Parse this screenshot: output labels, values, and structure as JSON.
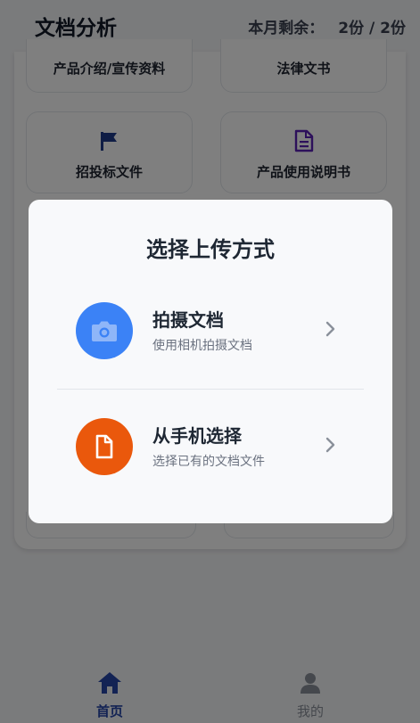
{
  "header": {
    "title": "文档分析",
    "quota_label": "本月剩余：",
    "quota_value": "2份 / 2份"
  },
  "categories": [
    {
      "label": "产品介绍/宣传资料",
      "icon": "none"
    },
    {
      "label": "法律文书",
      "icon": "none"
    },
    {
      "label": "招投标文件",
      "icon": "flag-icon",
      "color": "#1e3a8a"
    },
    {
      "label": "产品使用说明书",
      "icon": "document-icon",
      "color": "#5b21b6"
    }
  ],
  "modal": {
    "title": "选择上传方式",
    "options": [
      {
        "title": "拍摄文档",
        "subtitle": "使用相机拍摄文档",
        "icon": "camera-icon",
        "color": "#3b82f6"
      },
      {
        "title": "从手机选择",
        "subtitle": "选择已有的文档文件",
        "icon": "file-icon",
        "color": "#ea580c"
      }
    ]
  },
  "tabbar": {
    "tabs": [
      {
        "label": "首页",
        "icon": "home-icon",
        "active": true
      },
      {
        "label": "我的",
        "icon": "user-icon",
        "active": false
      }
    ]
  },
  "colors": {
    "accent": "#2647a8",
    "overlay": "rgba(0,0,0,0.5)",
    "modal_bg": "#f8f9fb"
  }
}
